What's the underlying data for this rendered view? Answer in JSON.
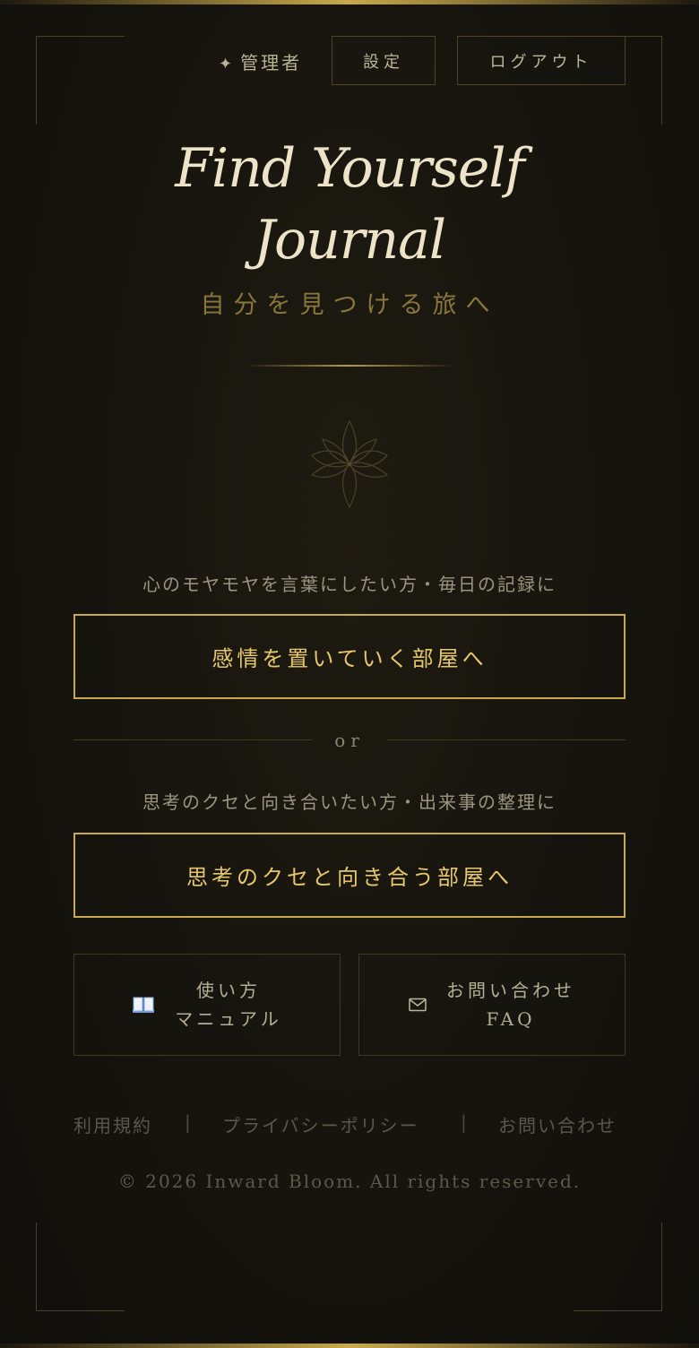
{
  "header": {
    "admin_label": "管理者",
    "admin_icon": "sparkle-icon",
    "settings_label": "設定",
    "logout_label": "ログアウト"
  },
  "hero": {
    "title_line1": "Find Yourself",
    "title_line2": "Journal",
    "subtitle": "自分を見つける旅へ",
    "emblem_icon": "lotus-icon"
  },
  "rooms": {
    "emotion_prompt": "心のモヤモヤを言葉にしたい方・毎日の記録に",
    "emotion_button": "感情を置いていく部屋へ",
    "or_label": "or",
    "thinking_prompt": "思考のクセと向き合いたい方・出来事の整理に",
    "thinking_button": "思考のクセと向き合う部屋へ"
  },
  "cards": {
    "manual_line1": "使い方",
    "manual_line2": "マニュアル",
    "manual_icon": "book-icon",
    "contact_line1": "お問い合わせ",
    "contact_line2": "FAQ",
    "contact_icon": "mail-icon"
  },
  "footer": {
    "terms": "利用規約",
    "separator": "|",
    "privacy": "プライバシーポリシー",
    "contact": "お問い合わせ",
    "copyright": "© 2026 Inward Bloom. All rights reserved."
  },
  "colors": {
    "accent_gold": "#c9a94a",
    "background": "#15130d",
    "title_text": "#ece3c8"
  }
}
